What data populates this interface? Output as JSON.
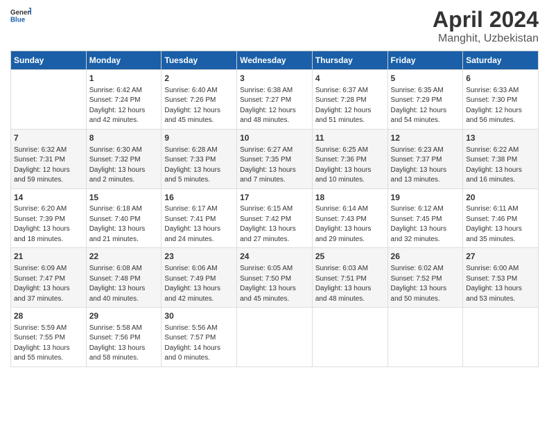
{
  "header": {
    "logo_general": "General",
    "logo_blue": "Blue",
    "title": "April 2024",
    "subtitle": "Manghit, Uzbekistan"
  },
  "calendar": {
    "days_of_week": [
      "Sunday",
      "Monday",
      "Tuesday",
      "Wednesday",
      "Thursday",
      "Friday",
      "Saturday"
    ],
    "weeks": [
      [
        {
          "day": "",
          "content": ""
        },
        {
          "day": "1",
          "content": "Sunrise: 6:42 AM\nSunset: 7:24 PM\nDaylight: 12 hours\nand 42 minutes."
        },
        {
          "day": "2",
          "content": "Sunrise: 6:40 AM\nSunset: 7:26 PM\nDaylight: 12 hours\nand 45 minutes."
        },
        {
          "day": "3",
          "content": "Sunrise: 6:38 AM\nSunset: 7:27 PM\nDaylight: 12 hours\nand 48 minutes."
        },
        {
          "day": "4",
          "content": "Sunrise: 6:37 AM\nSunset: 7:28 PM\nDaylight: 12 hours\nand 51 minutes."
        },
        {
          "day": "5",
          "content": "Sunrise: 6:35 AM\nSunset: 7:29 PM\nDaylight: 12 hours\nand 54 minutes."
        },
        {
          "day": "6",
          "content": "Sunrise: 6:33 AM\nSunset: 7:30 PM\nDaylight: 12 hours\nand 56 minutes."
        }
      ],
      [
        {
          "day": "7",
          "content": "Sunrise: 6:32 AM\nSunset: 7:31 PM\nDaylight: 12 hours\nand 59 minutes."
        },
        {
          "day": "8",
          "content": "Sunrise: 6:30 AM\nSunset: 7:32 PM\nDaylight: 13 hours\nand 2 minutes."
        },
        {
          "day": "9",
          "content": "Sunrise: 6:28 AM\nSunset: 7:33 PM\nDaylight: 13 hours\nand 5 minutes."
        },
        {
          "day": "10",
          "content": "Sunrise: 6:27 AM\nSunset: 7:35 PM\nDaylight: 13 hours\nand 7 minutes."
        },
        {
          "day": "11",
          "content": "Sunrise: 6:25 AM\nSunset: 7:36 PM\nDaylight: 13 hours\nand 10 minutes."
        },
        {
          "day": "12",
          "content": "Sunrise: 6:23 AM\nSunset: 7:37 PM\nDaylight: 13 hours\nand 13 minutes."
        },
        {
          "day": "13",
          "content": "Sunrise: 6:22 AM\nSunset: 7:38 PM\nDaylight: 13 hours\nand 16 minutes."
        }
      ],
      [
        {
          "day": "14",
          "content": "Sunrise: 6:20 AM\nSunset: 7:39 PM\nDaylight: 13 hours\nand 18 minutes."
        },
        {
          "day": "15",
          "content": "Sunrise: 6:18 AM\nSunset: 7:40 PM\nDaylight: 13 hours\nand 21 minutes."
        },
        {
          "day": "16",
          "content": "Sunrise: 6:17 AM\nSunset: 7:41 PM\nDaylight: 13 hours\nand 24 minutes."
        },
        {
          "day": "17",
          "content": "Sunrise: 6:15 AM\nSunset: 7:42 PM\nDaylight: 13 hours\nand 27 minutes."
        },
        {
          "day": "18",
          "content": "Sunrise: 6:14 AM\nSunset: 7:43 PM\nDaylight: 13 hours\nand 29 minutes."
        },
        {
          "day": "19",
          "content": "Sunrise: 6:12 AM\nSunset: 7:45 PM\nDaylight: 13 hours\nand 32 minutes."
        },
        {
          "day": "20",
          "content": "Sunrise: 6:11 AM\nSunset: 7:46 PM\nDaylight: 13 hours\nand 35 minutes."
        }
      ],
      [
        {
          "day": "21",
          "content": "Sunrise: 6:09 AM\nSunset: 7:47 PM\nDaylight: 13 hours\nand 37 minutes."
        },
        {
          "day": "22",
          "content": "Sunrise: 6:08 AM\nSunset: 7:48 PM\nDaylight: 13 hours\nand 40 minutes."
        },
        {
          "day": "23",
          "content": "Sunrise: 6:06 AM\nSunset: 7:49 PM\nDaylight: 13 hours\nand 42 minutes."
        },
        {
          "day": "24",
          "content": "Sunrise: 6:05 AM\nSunset: 7:50 PM\nDaylight: 13 hours\nand 45 minutes."
        },
        {
          "day": "25",
          "content": "Sunrise: 6:03 AM\nSunset: 7:51 PM\nDaylight: 13 hours\nand 48 minutes."
        },
        {
          "day": "26",
          "content": "Sunrise: 6:02 AM\nSunset: 7:52 PM\nDaylight: 13 hours\nand 50 minutes."
        },
        {
          "day": "27",
          "content": "Sunrise: 6:00 AM\nSunset: 7:53 PM\nDaylight: 13 hours\nand 53 minutes."
        }
      ],
      [
        {
          "day": "28",
          "content": "Sunrise: 5:59 AM\nSunset: 7:55 PM\nDaylight: 13 hours\nand 55 minutes."
        },
        {
          "day": "29",
          "content": "Sunrise: 5:58 AM\nSunset: 7:56 PM\nDaylight: 13 hours\nand 58 minutes."
        },
        {
          "day": "30",
          "content": "Sunrise: 5:56 AM\nSunset: 7:57 PM\nDaylight: 14 hours\nand 0 minutes."
        },
        {
          "day": "",
          "content": ""
        },
        {
          "day": "",
          "content": ""
        },
        {
          "day": "",
          "content": ""
        },
        {
          "day": "",
          "content": ""
        }
      ]
    ]
  }
}
